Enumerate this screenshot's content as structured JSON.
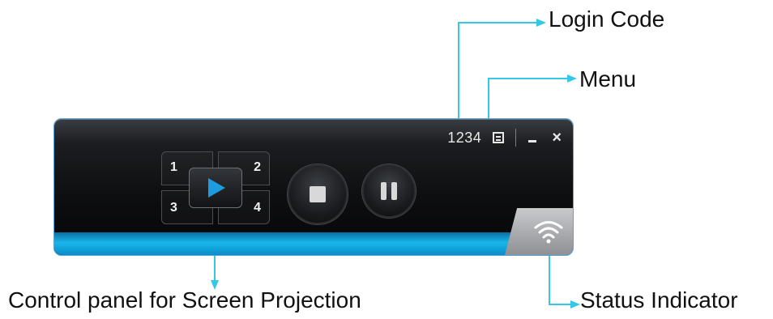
{
  "callouts": {
    "login_code": "Login Code",
    "menu": "Menu",
    "control_panel": "Control panel for Screen Projection",
    "status_indicator": "Status Indicator"
  },
  "widget": {
    "login_code_value": "1234",
    "quadrants": [
      "1",
      "2",
      "3",
      "4"
    ],
    "icons": {
      "menu": "menu-icon",
      "minimize": "minimize-icon",
      "close": "close-icon",
      "play": "play-icon",
      "stop": "stop-icon",
      "pause": "pause-icon",
      "status": "wifi-icon"
    },
    "close_glyph": "×"
  },
  "colors": {
    "callout_line": "#35c8e6",
    "accent_blue": "#19b6ea",
    "play_blue": "#1f9be0"
  }
}
